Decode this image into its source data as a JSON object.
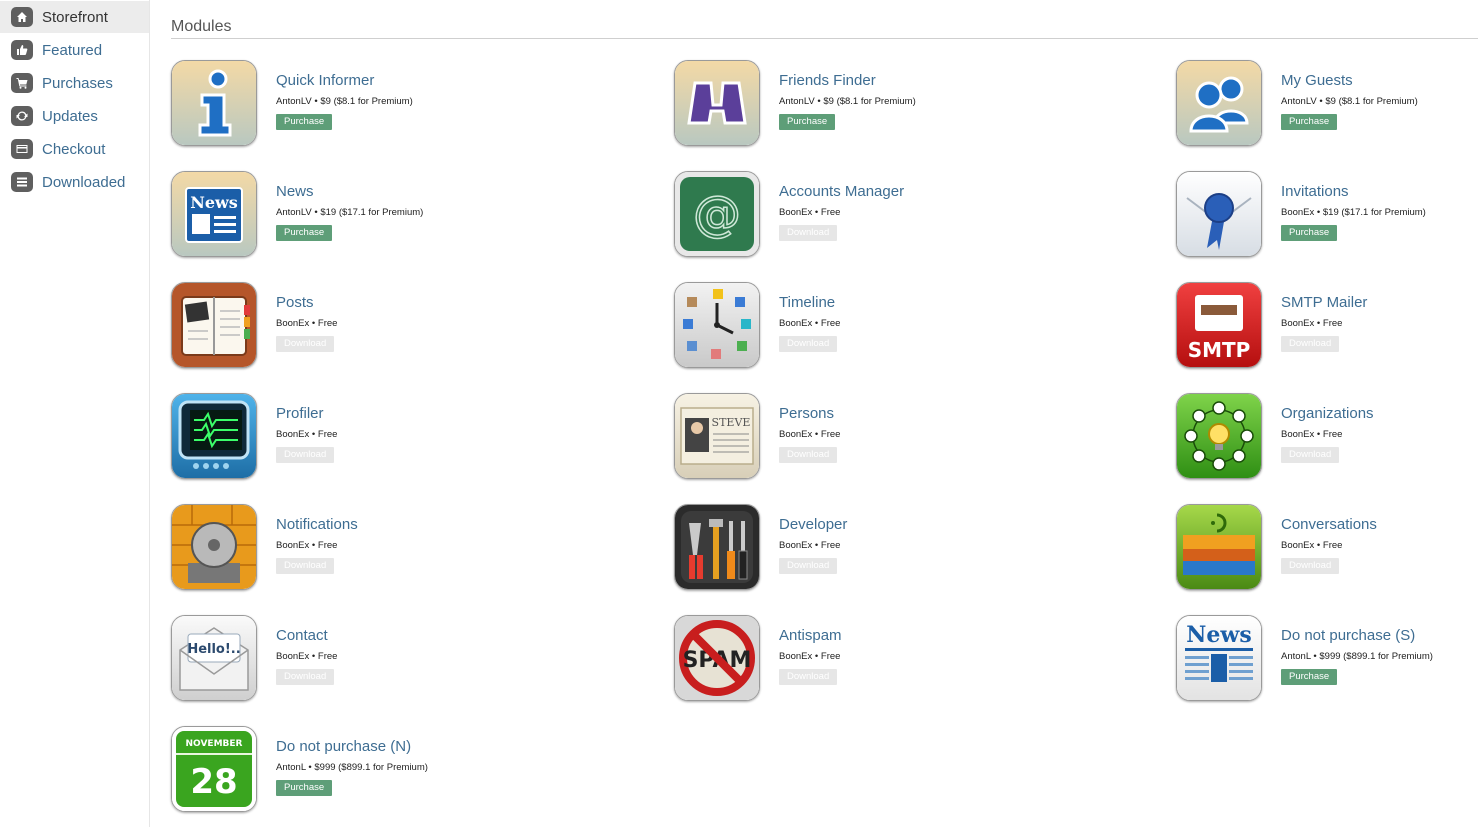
{
  "sidebar": {
    "items": [
      {
        "label": "Storefront",
        "icon": "home-icon",
        "active": true
      },
      {
        "label": "Featured",
        "icon": "thumbs-up-icon",
        "active": false
      },
      {
        "label": "Purchases",
        "icon": "cart-icon",
        "active": false
      },
      {
        "label": "Updates",
        "icon": "refresh-icon",
        "active": false
      },
      {
        "label": "Checkout",
        "icon": "credit-card-icon",
        "active": false
      },
      {
        "label": "Downloaded",
        "icon": "list-icon",
        "active": false
      }
    ]
  },
  "main": {
    "section_title": "Modules",
    "modules": [
      {
        "name": "Quick Informer",
        "author": "AntonLV",
        "price": "$9 ($8.1 for Premium)",
        "action": "Purchase",
        "icon": "info-icon",
        "accent": "#1f6fc4"
      },
      {
        "name": "Friends Finder",
        "author": "AntonLV",
        "price": "$9 ($8.1 for Premium)",
        "action": "Purchase",
        "icon": "binoculars-icon",
        "accent": "#5b3f9a"
      },
      {
        "name": "My Guests",
        "author": "AntonLV",
        "price": "$9 ($8.1 for Premium)",
        "action": "Purchase",
        "icon": "users-icon",
        "accent": "#1f6fc4"
      },
      {
        "name": "News",
        "author": "AntonLV",
        "price": "$19 ($17.1 for Premium)",
        "action": "Purchase",
        "icon": "news-icon",
        "accent": "#1b5ea8"
      },
      {
        "name": "Accounts Manager",
        "author": "BoonEx",
        "price": "Free",
        "action": "Download",
        "icon": "at-sign-icon",
        "accent": "#2f7a4e"
      },
      {
        "name": "Invitations",
        "author": "BoonEx",
        "price": "$19 ($17.1 for Premium)",
        "action": "Purchase",
        "icon": "envelope-seal-icon",
        "accent": "#2a5fb8"
      },
      {
        "name": "Posts",
        "author": "BoonEx",
        "price": "Free",
        "action": "Download",
        "icon": "notebook-icon",
        "accent": "#b5562a"
      },
      {
        "name": "Timeline",
        "author": "BoonEx",
        "price": "Free",
        "action": "Download",
        "icon": "clock-icon",
        "accent": "#8a8a8a"
      },
      {
        "name": "SMTP Mailer",
        "author": "BoonEx",
        "price": "Free",
        "action": "Download",
        "icon": "smtp-icon",
        "accent": "#d11f1f"
      },
      {
        "name": "Profiler",
        "author": "BoonEx",
        "price": "Free",
        "action": "Download",
        "icon": "monitor-icon",
        "accent": "#2a8fcf"
      },
      {
        "name": "Persons",
        "author": "BoonEx",
        "price": "Free",
        "action": "Download",
        "icon": "business-card-icon",
        "accent": "#c9c0a8"
      },
      {
        "name": "Organizations",
        "author": "BoonEx",
        "price": "Free",
        "action": "Download",
        "icon": "network-icon",
        "accent": "#3aa51f"
      },
      {
        "name": "Notifications",
        "author": "BoonEx",
        "price": "Free",
        "action": "Download",
        "icon": "bell-icon",
        "accent": "#e89a1c"
      },
      {
        "name": "Developer",
        "author": "BoonEx",
        "price": "Free",
        "action": "Download",
        "icon": "tools-icon",
        "accent": "#333333"
      },
      {
        "name": "Conversations",
        "author": "BoonEx",
        "price": "Free",
        "action": "Download",
        "icon": "layers-icon",
        "accent": "#7cb82f"
      },
      {
        "name": "Contact",
        "author": "BoonEx",
        "price": "Free",
        "action": "Download",
        "icon": "mail-hello-icon",
        "accent": "#d9d9d9"
      },
      {
        "name": "Antispam",
        "author": "BoonEx",
        "price": "Free",
        "action": "Download",
        "icon": "no-spam-icon",
        "accent": "#c81e1e"
      },
      {
        "name": "Do not purchase (S)",
        "author": "AntonL",
        "price": "$999 ($899.1 for Premium)",
        "action": "Purchase",
        "icon": "newspaper-icon",
        "accent": "#1b5ea8"
      },
      {
        "name": "Do not purchase (N)",
        "author": "AntonL",
        "price": "$999 ($899.1 for Premium)",
        "action": "Purchase",
        "icon": "calendar-icon",
        "accent": "#3aa51f"
      }
    ],
    "icon_text": {
      "news": "News",
      "smtp": "SMTP",
      "spam": "SPAM",
      "hello": "Hello!..",
      "month": "NOVEMBER",
      "day": "28",
      "card_name": "STEVE"
    },
    "separator": " • "
  }
}
